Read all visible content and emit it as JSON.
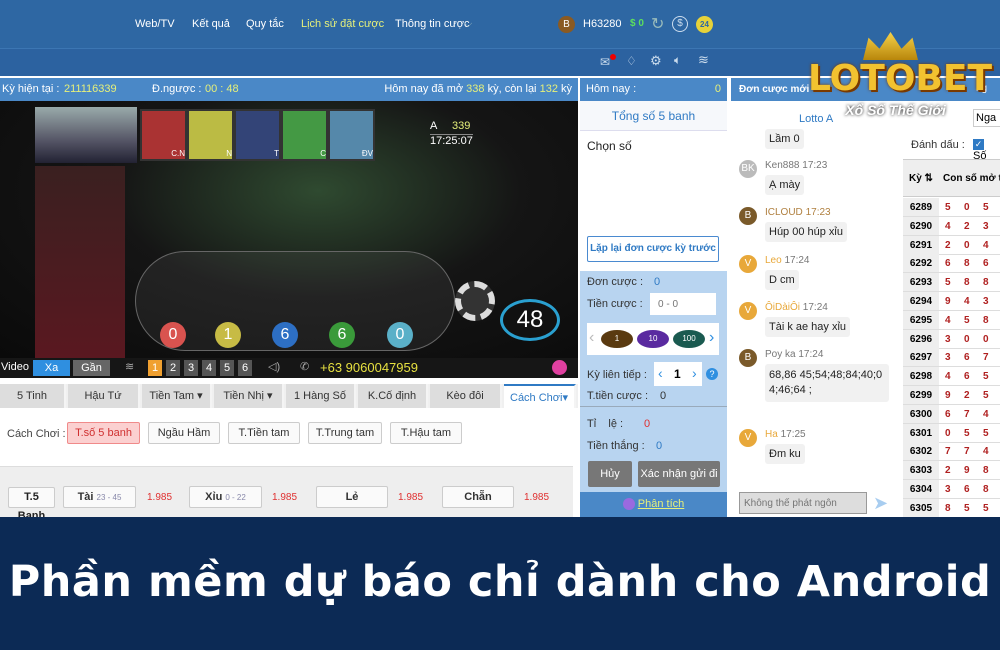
{
  "header": {
    "nav": [
      "Web/TV",
      "Kết quả",
      "Quy tắc",
      "Lịch sử đặt cược",
      "Thông tin cược"
    ],
    "user_initial": "B",
    "username": "H63280",
    "balance": "$ 0",
    "badge": "24"
  },
  "info": {
    "current_label": "Kỳ hiện tại :",
    "current": "211116339",
    "countdown_label": "Đ.ngược :",
    "countdown": "00 : 48",
    "today_pre": "Hôm nay đã mở",
    "opened": "338",
    "mid": "kỳ, còn lại",
    "remaining": "132",
    "suffix": "kỳ"
  },
  "video": {
    "ball_labels": [
      "C.N",
      "N",
      "T",
      "C",
      "ĐV"
    ],
    "round_letter": "A",
    "round": "339",
    "clock": "17:25:07",
    "balls": [
      "0",
      "1",
      "6",
      "6",
      "0"
    ],
    "timer": "48",
    "ball_colors": [
      "#d9534f",
      "#d4c74a",
      "#2d6fc4",
      "#3a9a3a",
      "#5ab0c8"
    ]
  },
  "vbar": {
    "video": "Video",
    "far": "Xa",
    "near": "Gần",
    "channels": [
      "1",
      "2",
      "3",
      "4",
      "5",
      "6"
    ],
    "phone": "+63 9060047959"
  },
  "tabs": [
    "5 Tinh",
    "Hậu Tứ",
    "Tiền Tam ▾",
    "Tiền Nhị ▾",
    "1 Hàng Số",
    "K.Cố định",
    "Kèo đôi",
    "Cách Chơi▾"
  ],
  "play": {
    "label": "Cách Chơi :",
    "options": [
      "T.số 5 banh",
      "Ngầu Hầm",
      "T.Tiền tam",
      "T.Trung tam",
      "T.Hậu tam"
    ]
  },
  "bets": {
    "group": "T.5 Banh",
    "items": [
      {
        "name": "Tài",
        "range": "23 - 45",
        "odds": "1.985"
      },
      {
        "name": "Xỉu",
        "range": "0 - 22",
        "odds": "1.985"
      },
      {
        "name": "Lẻ",
        "range": "",
        "odds": "1.985"
      },
      {
        "name": "Chẵn",
        "range": "",
        "odds": "1.985"
      }
    ]
  },
  "mid": {
    "today_label": "Hôm nay :",
    "today": "0",
    "title": "Tổng số 5 banh",
    "choose": "Chọn số",
    "repeat": "Lặp lại đơn cược kỳ trước",
    "orders_label": "Đơn cược :",
    "orders": "0",
    "amount_label": "Tiền cược :",
    "amount_placeholder": "0 - 0",
    "chips": [
      "1",
      "10",
      "100"
    ],
    "consec_label": "Kỳ liên tiếp :",
    "consec": "1",
    "total_label": "T.tiền cược :",
    "total": "0",
    "ratio_label": "Tỉ    lệ :",
    "ratio": "0",
    "win_label": "Tiền thắng :",
    "win": "0",
    "cancel": "Hủy",
    "confirm": "Xác nhận gửi đi",
    "analysis": "Phân tích"
  },
  "chat": {
    "header": "Đơn cược mới",
    "tab": "Lotto A",
    "messages": [
      {
        "text": "Lầm 0"
      },
      {
        "av": "BK",
        "user": "Ken888",
        "time": "17:23",
        "text": "Ạ mày",
        "color": "#bbbbbb"
      },
      {
        "av": "B",
        "user": "ICLOUD",
        "time": "17:23",
        "text": "Húp 00 húp xỉu",
        "color": "#7a5a2a"
      },
      {
        "av": "V",
        "user": "Leo",
        "time": "17:24",
        "text": "D cm",
        "color": "#e8a83a"
      },
      {
        "av": "V",
        "user": "ÔiDàiÔi",
        "time": "17:24",
        "text": "Tài k ae hay xỉu",
        "color": "#e8a83a"
      },
      {
        "av": "B",
        "user": "Poy ka",
        "time": "17:24",
        "text": "68,86 45;54;48;84;40;04;46;64 ;",
        "color": "#7a5a2a"
      },
      {
        "av": "V",
        "user": "Ha",
        "time": "17:25",
        "text": "Đm ku",
        "color": "#e8a83a"
      }
    ],
    "input_placeholder": "Không thể phát ngôn"
  },
  "table": {
    "header_tab": "ng",
    "tab2": "Nga",
    "mark_label": "Đánh dấu :",
    "mark_option": "Số",
    "col_ky": "Kỳ ⇅",
    "col_num": "Con số mở th",
    "rows": [
      [
        "6289",
        "5",
        "0",
        "5"
      ],
      [
        "6290",
        "4",
        "2",
        "3"
      ],
      [
        "6291",
        "2",
        "0",
        "4"
      ],
      [
        "6292",
        "6",
        "8",
        "6"
      ],
      [
        "6293",
        "5",
        "8",
        "8"
      ],
      [
        "6294",
        "9",
        "4",
        "3"
      ],
      [
        "6295",
        "4",
        "5",
        "8"
      ],
      [
        "6296",
        "3",
        "0",
        "0"
      ],
      [
        "6297",
        "3",
        "6",
        "7"
      ],
      [
        "6298",
        "4",
        "6",
        "5"
      ],
      [
        "6299",
        "9",
        "2",
        "5"
      ],
      [
        "6300",
        "6",
        "7",
        "4"
      ],
      [
        "6301",
        "0",
        "5",
        "5"
      ],
      [
        "6302",
        "7",
        "7",
        "4"
      ],
      [
        "6303",
        "2",
        "9",
        "8"
      ],
      [
        "6304",
        "3",
        "6",
        "8"
      ],
      [
        "6305",
        "8",
        "5",
        "5"
      ]
    ]
  },
  "logo": {
    "brand": "LOTOBET",
    "tagline": "Xổ Số Thế Giới"
  },
  "banner": {
    "text": "Phần mềm dự báo chỉ dành cho Android"
  }
}
